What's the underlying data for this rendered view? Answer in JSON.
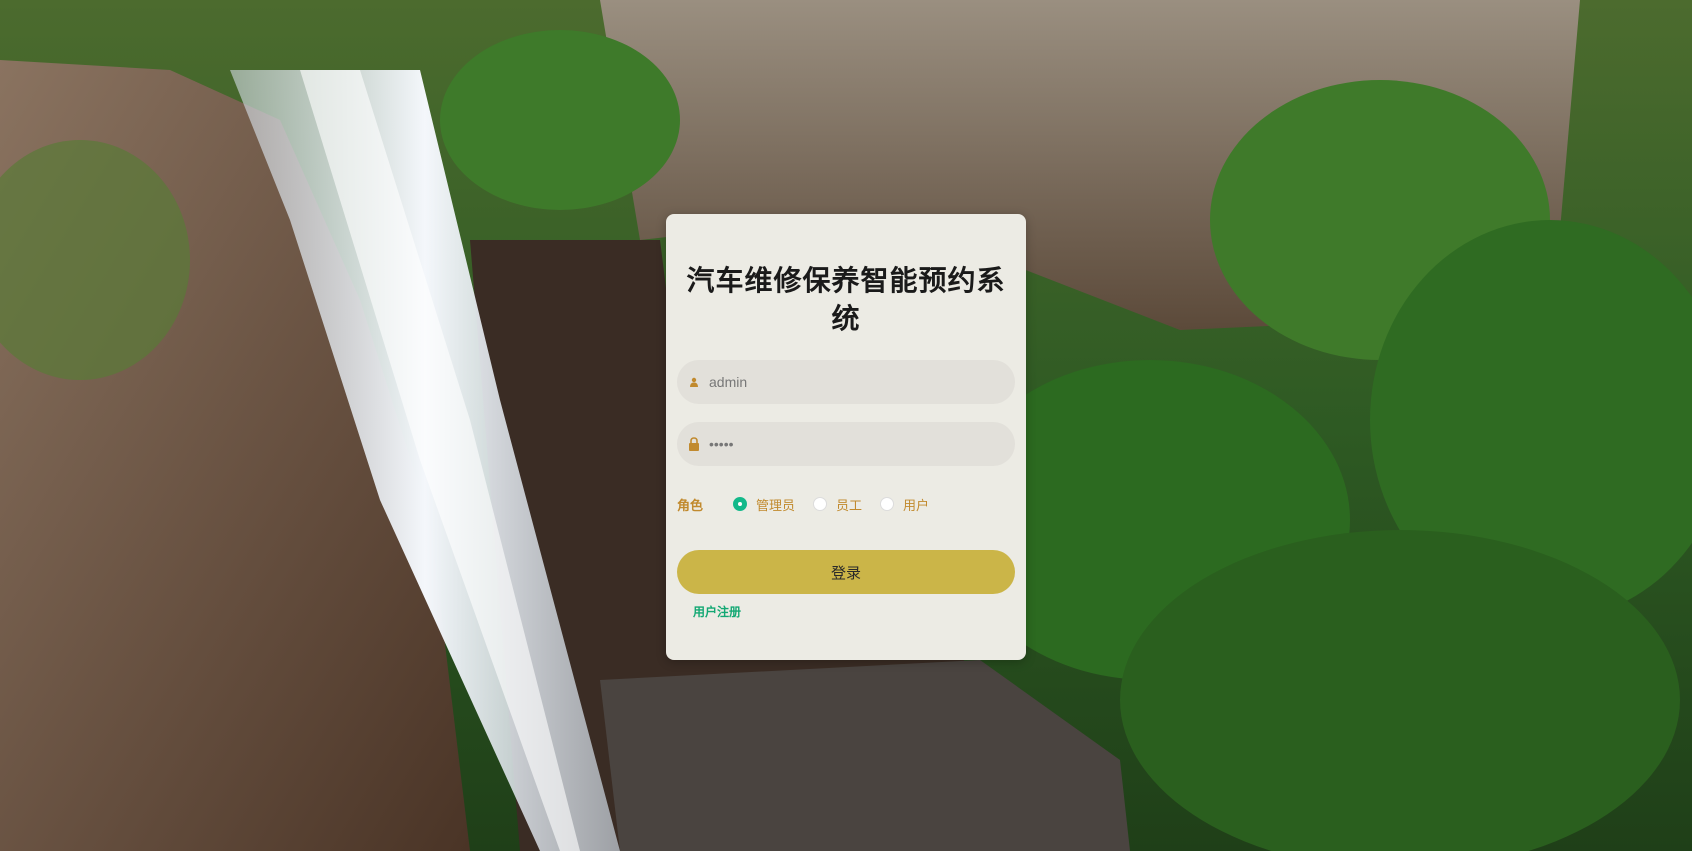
{
  "login": {
    "title": "汽车维修保养智能预约系统",
    "username": {
      "value": "admin",
      "placeholder": ""
    },
    "password": {
      "value": "•••••",
      "placeholder": ""
    },
    "role_label": "角色",
    "roles": [
      {
        "label": "管理员",
        "checked": true
      },
      {
        "label": "员工",
        "checked": false
      },
      {
        "label": "用户",
        "checked": false
      }
    ],
    "login_button": "登录",
    "register_link": "用户注册"
  },
  "colors": {
    "accent_gold": "#cbb548",
    "label_orange": "#c18a2e",
    "radio_green": "#13b98a",
    "link_green": "#13a873",
    "card_bg": "#ecebe4"
  },
  "icons": {
    "username": "user-icon",
    "password": "lock-icon"
  }
}
